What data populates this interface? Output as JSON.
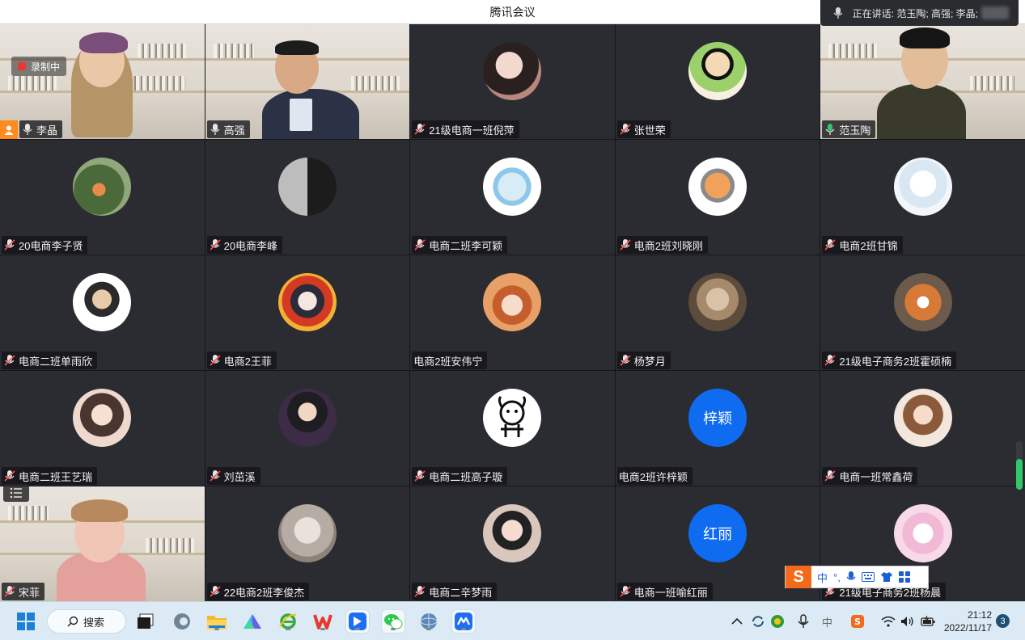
{
  "window": {
    "title": "腾讯会议"
  },
  "speaking": {
    "text": "正在讲话: 范玉陶; 高强; 李晶;"
  },
  "recording": {
    "label": "录制中"
  },
  "participants": [
    {
      "name": "李晶",
      "kind": "camera"
    },
    {
      "name": "高强",
      "kind": "camera"
    },
    {
      "name": "21级电商一班倪萍",
      "kind": "avatar"
    },
    {
      "name": "张世荣",
      "kind": "avatar"
    },
    {
      "name": "范玉陶",
      "kind": "camera"
    },
    {
      "name": "20电商李子贤",
      "kind": "avatar"
    },
    {
      "name": "20电商李峰",
      "kind": "avatar"
    },
    {
      "name": "电商二班李可颖",
      "kind": "avatar"
    },
    {
      "name": "电商2班刘晓刚",
      "kind": "avatar"
    },
    {
      "name": "电商2班甘锦",
      "kind": "avatar"
    },
    {
      "name": "电商二班单雨欣",
      "kind": "avatar"
    },
    {
      "name": "电商2王菲",
      "kind": "avatar"
    },
    {
      "name": "电商2班安伟宁",
      "kind": "avatar"
    },
    {
      "name": "杨梦月",
      "kind": "avatar"
    },
    {
      "name": "21级电子商务2班霍硕楠",
      "kind": "avatar"
    },
    {
      "name": "电商二班王艺瑞",
      "kind": "avatar"
    },
    {
      "name": "刘茁溪",
      "kind": "avatar"
    },
    {
      "name": "电商二班高子璇",
      "kind": "avatar"
    },
    {
      "name": "电商2班许梓颖",
      "kind": "text",
      "initials": "梓颖"
    },
    {
      "name": "电商一班常鑫荷",
      "kind": "avatar"
    },
    {
      "name": "宋菲",
      "kind": "camera"
    },
    {
      "name": "22电商2班李俊杰",
      "kind": "avatar"
    },
    {
      "name": "电商二辛梦雨",
      "kind": "avatar"
    },
    {
      "name": "电商一班喻红丽",
      "kind": "text",
      "initials": "红丽"
    },
    {
      "name": "21级电子商务2班杨晨",
      "kind": "avatar"
    }
  ],
  "ime": {
    "mode": "中",
    "punct": "°,"
  },
  "taskbar": {
    "search_label": "搜索",
    "time": "21:12",
    "date": "2022/11/17",
    "notification_count": "3",
    "ime_indicator": "中"
  },
  "colors": {
    "accent": "#0f6bf0",
    "speaking": "#2fa85a",
    "host": "#ff8a1e"
  }
}
